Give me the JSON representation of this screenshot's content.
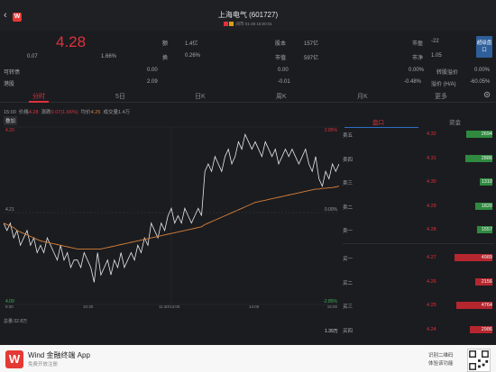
{
  "header": {
    "back_icon": "chevron-left-icon",
    "app_icon_letter": "W",
    "title": "上海电气 (601727)",
    "subtitle": "闭市 01-28 16:00:01",
    "tag_colors": [
      "#e0313b",
      "#d4a017"
    ]
  },
  "quote": {
    "price": "4.28",
    "change": "0.07",
    "change_pct": "1.66%",
    "fields_col1": [
      {
        "label": "额",
        "value": "1.4亿"
      },
      {
        "label": "换",
        "value": "0.26%"
      }
    ],
    "fields_col2": [
      {
        "label": "股本",
        "value": "157亿"
      },
      {
        "label": "市值",
        "value": "597亿"
      }
    ],
    "fields_col3": [
      {
        "label": "市盈",
        "value": "-22"
      },
      {
        "label": "市净",
        "value": "1.05"
      }
    ],
    "super_button": "超级盘口",
    "rows": [
      {
        "label": "可转债",
        "value1": "0.00",
        "value2": "0.00",
        "pct": "0.00%",
        "extra_label": "转股溢价",
        "extra_value": "0.00%"
      },
      {
        "label": "港股",
        "value1": "2.09",
        "value2": "-0.01",
        "pct": "-0.48%",
        "extra_label": "溢价 (H/A)",
        "extra_value": "-60.05%"
      }
    ]
  },
  "tabs": [
    {
      "label": "分时",
      "active": true
    },
    {
      "label": "5日",
      "active": false
    },
    {
      "label": "日K",
      "active": false
    },
    {
      "label": "周K",
      "active": false
    },
    {
      "label": "月K",
      "active": false
    },
    {
      "label": "更多",
      "active": false
    }
  ],
  "settings_icon": "gear-icon",
  "chart_info": {
    "time": "15:00",
    "price_label": "价格",
    "price": "4.28",
    "change_label": "涨跌",
    "change": "0.07(1.66%)",
    "avg_label": "均价",
    "avg": "4.25",
    "vol_label": "成交量",
    "vol": "1.4万",
    "overlay_button": "叠加"
  },
  "chart_data": {
    "type": "line",
    "y_ticks_left": [
      "4.33",
      "4.21",
      "4.09"
    ],
    "y_ticks_right": [
      "2.85%",
      "0.00%",
      "-2.85%"
    ],
    "x_ticks": [
      "9:30",
      "10:30",
      "11:30/13:00",
      "14:00",
      "15:00"
    ],
    "ylim": [
      4.09,
      4.33
    ],
    "series": [
      {
        "values": [
          4.2,
          4.19,
          4.2,
          4.18,
          4.19,
          4.17,
          4.18,
          4.19,
          4.17,
          4.18,
          4.16,
          4.17,
          4.16,
          4.18,
          4.17,
          4.16,
          4.15,
          4.17,
          4.15,
          4.16,
          4.14,
          4.15,
          4.15,
          4.14,
          4.16,
          4.15,
          4.14,
          4.12,
          4.16,
          4.13,
          4.14,
          4.15,
          4.13,
          4.15,
          4.14,
          4.16,
          4.14,
          4.15,
          4.16,
          4.15,
          4.17,
          4.16,
          4.18,
          4.17,
          4.2,
          4.19,
          4.18,
          4.2,
          4.19,
          4.21,
          4.22,
          4.2,
          4.21,
          4.2,
          4.22,
          4.21,
          4.2,
          4.21,
          4.22,
          4.21,
          4.27,
          4.28,
          4.27,
          4.29,
          4.28,
          4.27,
          4.29,
          4.3,
          4.28,
          4.29,
          4.31,
          4.3,
          4.32,
          4.31,
          4.3,
          4.31,
          4.3,
          4.29,
          4.31,
          4.3,
          4.29,
          4.3,
          4.28,
          4.29,
          4.3,
          4.29,
          4.3,
          4.29,
          4.28,
          4.29,
          4.3,
          4.28,
          4.27,
          4.29,
          4.26,
          4.25,
          4.27,
          4.26,
          4.28,
          4.27,
          4.28
        ],
        "color": "#e8e8ea"
      },
      {
        "name": "均价",
        "values": [
          4.2,
          4.198,
          4.196,
          4.194,
          4.19,
          4.188,
          4.186,
          4.184,
          4.182,
          4.18,
          4.178,
          4.176,
          4.175,
          4.174,
          4.173,
          4.172,
          4.171,
          4.17,
          4.169,
          4.168,
          4.167,
          4.166,
          4.165,
          4.165,
          4.165,
          4.165,
          4.165,
          4.165,
          4.165,
          4.165,
          4.166,
          4.167,
          4.168,
          4.169,
          4.17,
          4.171,
          4.172,
          4.173,
          4.174,
          4.175,
          4.176,
          4.177,
          4.178,
          4.179,
          4.18,
          4.181,
          4.182,
          4.183,
          4.184,
          4.185,
          4.186,
          4.187,
          4.188,
          4.189,
          4.19,
          4.191,
          4.192,
          4.193,
          4.194,
          4.195,
          4.198,
          4.2,
          4.202,
          4.204,
          4.206,
          4.208,
          4.21,
          4.212,
          4.214,
          4.216,
          4.218,
          4.22,
          4.222,
          4.224,
          4.226,
          4.228,
          4.229,
          4.23,
          4.231,
          4.232,
          4.233,
          4.234,
          4.235,
          4.236,
          4.237,
          4.238,
          4.239,
          4.24,
          4.241,
          4.242,
          4.243,
          4.244,
          4.245,
          4.246,
          4.246,
          4.247,
          4.247,
          4.248,
          4.248,
          4.249,
          4.25
        ],
        "color": "#d6813a"
      }
    ],
    "volume_label": "总量:32.8万",
    "volume_box": "1.39万"
  },
  "orderbook": {
    "tabs": [
      {
        "label": "盘口",
        "active": true
      },
      {
        "label": "资金",
        "active": false
      }
    ],
    "sell": [
      {
        "label": "卖五",
        "price": "4.32",
        "vol": "2694",
        "level": 0.68
      },
      {
        "label": "卖四",
        "price": "4.31",
        "vol": "2886",
        "level": 0.72
      },
      {
        "label": "卖三",
        "price": "4.30",
        "vol": "1310",
        "level": 0.34
      },
      {
        "label": "卖二",
        "price": "4.29",
        "vol": "1820",
        "level": 0.46
      },
      {
        "label": "卖一",
        "price": "4.28",
        "vol": "1557",
        "level": 0.4
      }
    ],
    "buy": [
      {
        "label": "买一",
        "price": "4.27",
        "vol": "4989",
        "level": 1.0
      },
      {
        "label": "买二",
        "price": "4.26",
        "vol": "2156",
        "level": 0.45
      },
      {
        "label": "买三",
        "price": "4.25",
        "vol": "4764",
        "level": 0.96
      },
      {
        "label": "买四",
        "price": "4.24",
        "vol": "2986",
        "level": 0.6
      }
    ]
  },
  "footer": {
    "logo_letter": "W",
    "app_name": "Wind 金融终端 App",
    "app_sub": "免费开放注册",
    "qr_line1": "识别二维码",
    "qr_line2": "体验该功能",
    "qr_icon": "qr-code-icon"
  }
}
